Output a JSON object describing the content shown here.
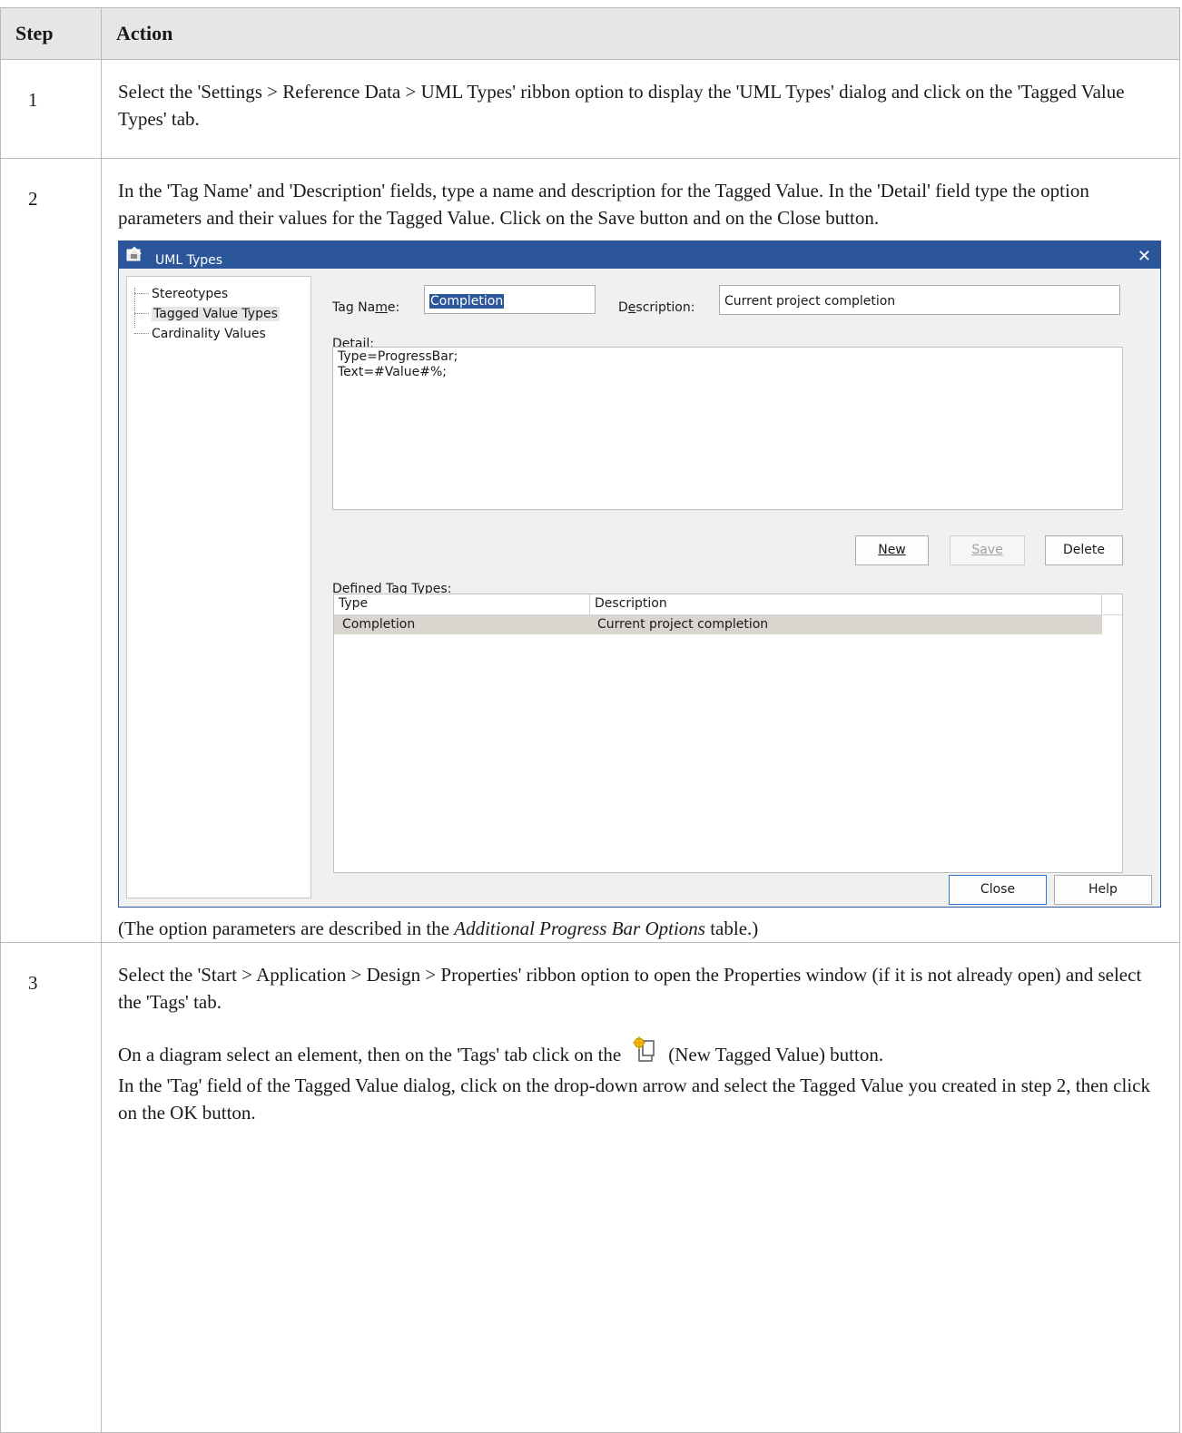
{
  "table": {
    "headers": {
      "step": "Step",
      "action": "Action"
    },
    "rows": [
      {
        "step": "1",
        "text": "Select the 'Settings > Reference Data > UML Types' ribbon option to display the 'UML Types' dialog and click on the 'Tagged Value Types' tab."
      },
      {
        "step": "2",
        "text": "In the 'Tag Name' and 'Description' fields, type a name and description for the Tagged Value. In the 'Detail' field type the option parameters and their values for the Tagged Value. Click on the Save button and on the Close button.",
        "caption_before": "(The option parameters are described in the ",
        "caption_italic": "Additional Progress Bar Options",
        "caption_after": " table.)"
      },
      {
        "step": "3",
        "text": "Select the 'Start > Application > Design > Properties' ribbon option to open the Properties window (if it is not already open) and select the 'Tags' tab.",
        "text2_before": "On a diagram select an element, then on the 'Tags' tab click on the",
        "text2_after": "(New Tagged Value) button.",
        "text3": "In the 'Tag' field of the Tagged Value dialog, click on the drop-down arrow and select the Tagged Value you created in step 2, then click on the OK button."
      }
    ]
  },
  "dialog": {
    "title": "UML Types",
    "close_glyph": "✕",
    "tree": [
      "Stereotypes",
      "Tagged Value Types",
      "Cardinality Values"
    ],
    "tag_name_label_pre": "Tag Na",
    "tag_name_label_u": "m",
    "tag_name_label_post": "e:",
    "tag_name_value": "Completion",
    "description_label_pre": "D",
    "description_label_u": "e",
    "description_label_post": "scription:",
    "description_value": "Current project completion",
    "detail_label_pre": "De",
    "detail_label_u": "t",
    "detail_label_post": "ail:",
    "detail_value": "Type=ProgressBar;\nText=#Value#%;",
    "buttons": {
      "new": "New",
      "save": "Save",
      "delete": "Delete",
      "close": "Close",
      "help": "Help"
    },
    "defined_label_pre": "De",
    "defined_label_u": "f",
    "defined_label_post": "ined Tag Types:",
    "list_columns": [
      "Type",
      "Description"
    ],
    "list_rows": [
      {
        "type": "Completion",
        "description": "Current project completion"
      }
    ]
  },
  "colors": {
    "title_bar": "#2b579a",
    "selection_row": "#d9d4cd",
    "header_bg": "#e6e6e6"
  },
  "icons": {
    "dialog_icon": "uml-types-dialog-icon",
    "new_tagged_value": "new-tagged-value-icon"
  }
}
